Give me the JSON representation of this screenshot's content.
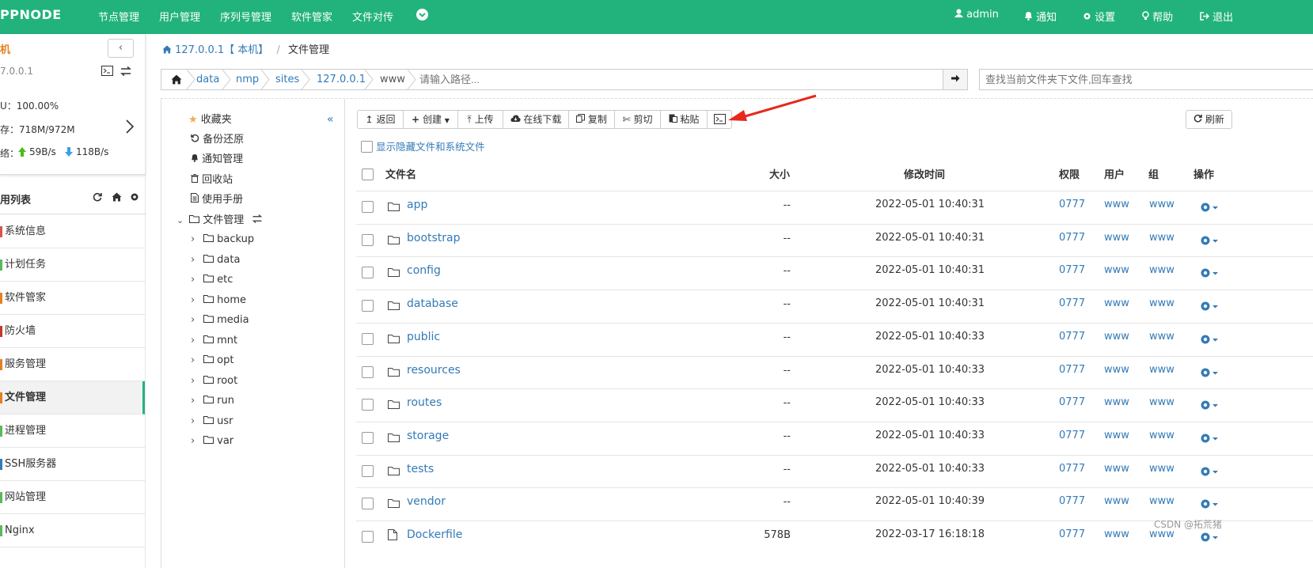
{
  "topbar": {
    "logo": "PPNODE",
    "nav": [
      "节点管理",
      "用户管理",
      "序列号管理",
      "软件管家",
      "文件对传"
    ],
    "user": "admin",
    "notify": "通知",
    "settings": "设置",
    "help": "帮助",
    "logout": "退出"
  },
  "sidebar": {
    "host_title": "机",
    "host_ip": "7.0.0.1",
    "cpu": "U：100.00%",
    "mem": "存：718M/972M",
    "net_label": "络：",
    "net_up": "59B/s",
    "net_down": "118B/s",
    "list_title": "用列表",
    "items": [
      {
        "label": "系统信息",
        "color": "#d9534f"
      },
      {
        "label": "计划任务",
        "color": "#5cb85c"
      },
      {
        "label": "软件管家",
        "color": "#e67e22"
      },
      {
        "label": "防火墙",
        "color": "#c0392b"
      },
      {
        "label": "服务管理",
        "color": "#e67e22"
      },
      {
        "label": "文件管理",
        "color": "#e67e22"
      },
      {
        "label": "进程管理",
        "color": "#5cb85c"
      },
      {
        "label": "SSH服务器",
        "color": "#337ab7"
      },
      {
        "label": "网站管理",
        "color": "#5cb85c"
      },
      {
        "label": "Nginx",
        "color": "#5cb85c"
      }
    ]
  },
  "breadcrumb": {
    "host": "127.0.0.1【 本机】",
    "sep": "/",
    "page": "文件管理"
  },
  "path": {
    "segments": [
      "data",
      "nmp",
      "sites",
      "127.0.0.1",
      "www"
    ],
    "placeholder": "请输入路径...",
    "search_placeholder": "查找当前文件夹下文件,回车查找"
  },
  "tree": {
    "favorites": "收藏夹",
    "backup": "备份还原",
    "notify": "通知管理",
    "recycle": "回收站",
    "manual": "使用手册",
    "files": "文件管理",
    "folders": [
      "backup",
      "data",
      "etc",
      "home",
      "media",
      "mnt",
      "opt",
      "root",
      "run",
      "usr",
      "var"
    ]
  },
  "toolbar": {
    "back": "返回",
    "create": "创建",
    "upload": "上传",
    "download": "在线下载",
    "copy": "复制",
    "cut": "剪切",
    "paste": "粘贴",
    "refresh": "刷新"
  },
  "show_hidden": "显示隐藏文件和系统文件",
  "table": {
    "headers": {
      "name": "文件名",
      "size": "大小",
      "mtime": "修改时间",
      "perm": "权限",
      "user": "用户",
      "group": "组",
      "ops": "操作"
    },
    "rows": [
      {
        "name": "app",
        "size": "--",
        "mtime": "2022-05-01 10:40:31",
        "perm": "0777",
        "user": "www",
        "group": "www"
      },
      {
        "name": "bootstrap",
        "size": "--",
        "mtime": "2022-05-01 10:40:31",
        "perm": "0777",
        "user": "www",
        "group": "www"
      },
      {
        "name": "config",
        "size": "--",
        "mtime": "2022-05-01 10:40:31",
        "perm": "0777",
        "user": "www",
        "group": "www"
      },
      {
        "name": "database",
        "size": "--",
        "mtime": "2022-05-01 10:40:31",
        "perm": "0777",
        "user": "www",
        "group": "www"
      },
      {
        "name": "public",
        "size": "--",
        "mtime": "2022-05-01 10:40:33",
        "perm": "0777",
        "user": "www",
        "group": "www"
      },
      {
        "name": "resources",
        "size": "--",
        "mtime": "2022-05-01 10:40:33",
        "perm": "0777",
        "user": "www",
        "group": "www"
      },
      {
        "name": "routes",
        "size": "--",
        "mtime": "2022-05-01 10:40:33",
        "perm": "0777",
        "user": "www",
        "group": "www"
      },
      {
        "name": "storage",
        "size": "--",
        "mtime": "2022-05-01 10:40:33",
        "perm": "0777",
        "user": "www",
        "group": "www"
      },
      {
        "name": "tests",
        "size": "--",
        "mtime": "2022-05-01 10:40:33",
        "perm": "0777",
        "user": "www",
        "group": "www"
      },
      {
        "name": "vendor",
        "size": "--",
        "mtime": "2022-05-01 10:40:39",
        "perm": "0777",
        "user": "www",
        "group": "www"
      },
      {
        "name": "Dockerfile",
        "size": "578B",
        "mtime": "2022-03-17 16:18:18",
        "perm": "0777",
        "user": "www",
        "group": "www"
      }
    ]
  },
  "watermark": "CSDN @拓荒猪",
  "colors": {
    "brand": "#22b37c",
    "link": "#337ab7",
    "arrow": "#e8281c"
  }
}
